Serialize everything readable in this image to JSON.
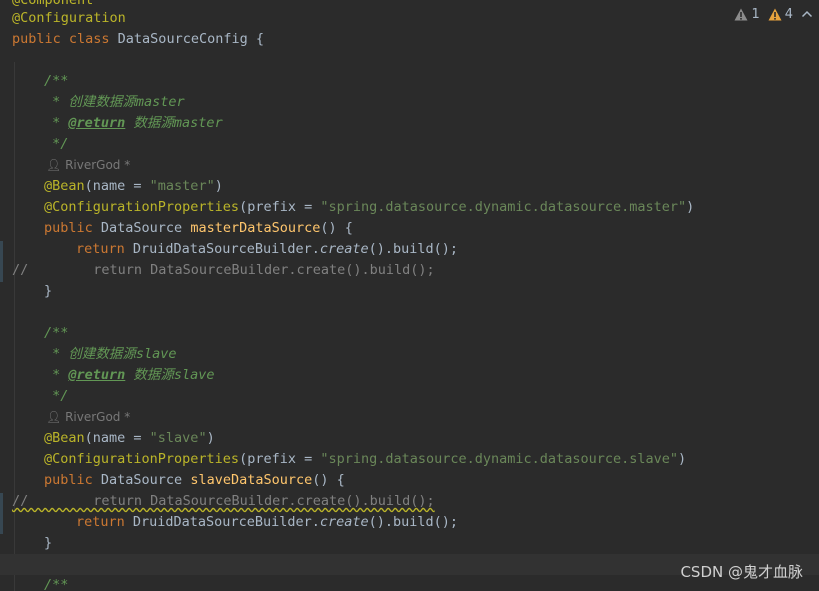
{
  "editor": {
    "inspections": {
      "weak_warnings": "1",
      "warnings": "4"
    },
    "lines": {
      "l0": "@Component",
      "l1": "@Configuration",
      "l2_kw": "public class ",
      "l2_name": "DataSourceConfig {",
      "l4": "/**",
      "l5_a": " * 创建数据源",
      "l5_b": "master",
      "l6_a": " * ",
      "l6_tag": "@return",
      "l6_b": " 数据源master",
      "l7": " */",
      "l8_author": "RiverGod *",
      "l9_ann": "@Bean",
      "l9_a": "(name = ",
      "l9_str": "\"master\"",
      "l9_b": ")",
      "l10_ann": "@ConfigurationProperties",
      "l10_a": "(prefix = ",
      "l10_str": "\"spring.datasource.dynamic.datasource.master\"",
      "l10_b": ")",
      "l11_kw": "public ",
      "l11_type": "DataSource ",
      "l11_method": "masterDataSource",
      "l11_b": "() {",
      "l12_kw": "return ",
      "l12_a": "DruidDataSourceBuilder.",
      "l12_call": "create",
      "l12_b": "().build();",
      "l13": "//        return DataSourceBuilder.create().build();",
      "l14": "}",
      "l16": "/**",
      "l17_a": " * 创建数据源",
      "l17_b": "slave",
      "l18_a": " * ",
      "l18_tag": "@return",
      "l18_b": " 数据源slave",
      "l19": " */",
      "l20_author": "RiverGod *",
      "l21_ann": "@Bean",
      "l21_a": "(name = ",
      "l21_str": "\"slave\"",
      "l21_b": ")",
      "l22_ann": "@ConfigurationProperties",
      "l22_a": "(prefix = ",
      "l22_str": "\"spring.datasource.dynamic.datasource.slave\"",
      "l22_b": ")",
      "l23_kw": "public ",
      "l23_type": "DataSource ",
      "l23_method": "slaveDataSource",
      "l23_b": "() {",
      "l24": "//        return DataSourceBuilder.create().build();",
      "l25_kw": "return ",
      "l25_a": "DruidDataSourceBuilder.",
      "l25_call": "create",
      "l25_b": "().build();",
      "l26": "}",
      "l28": "/**"
    }
  },
  "watermark": "CSDN @鬼才血脉",
  "colors": {
    "background": "#2b2b2b",
    "keyword": "#cc7832",
    "annotation": "#bbb529",
    "string": "#6a8759",
    "doc_comment": "#629755",
    "comment": "#808080",
    "method": "#ffc66d",
    "text": "#a9b7c6"
  }
}
